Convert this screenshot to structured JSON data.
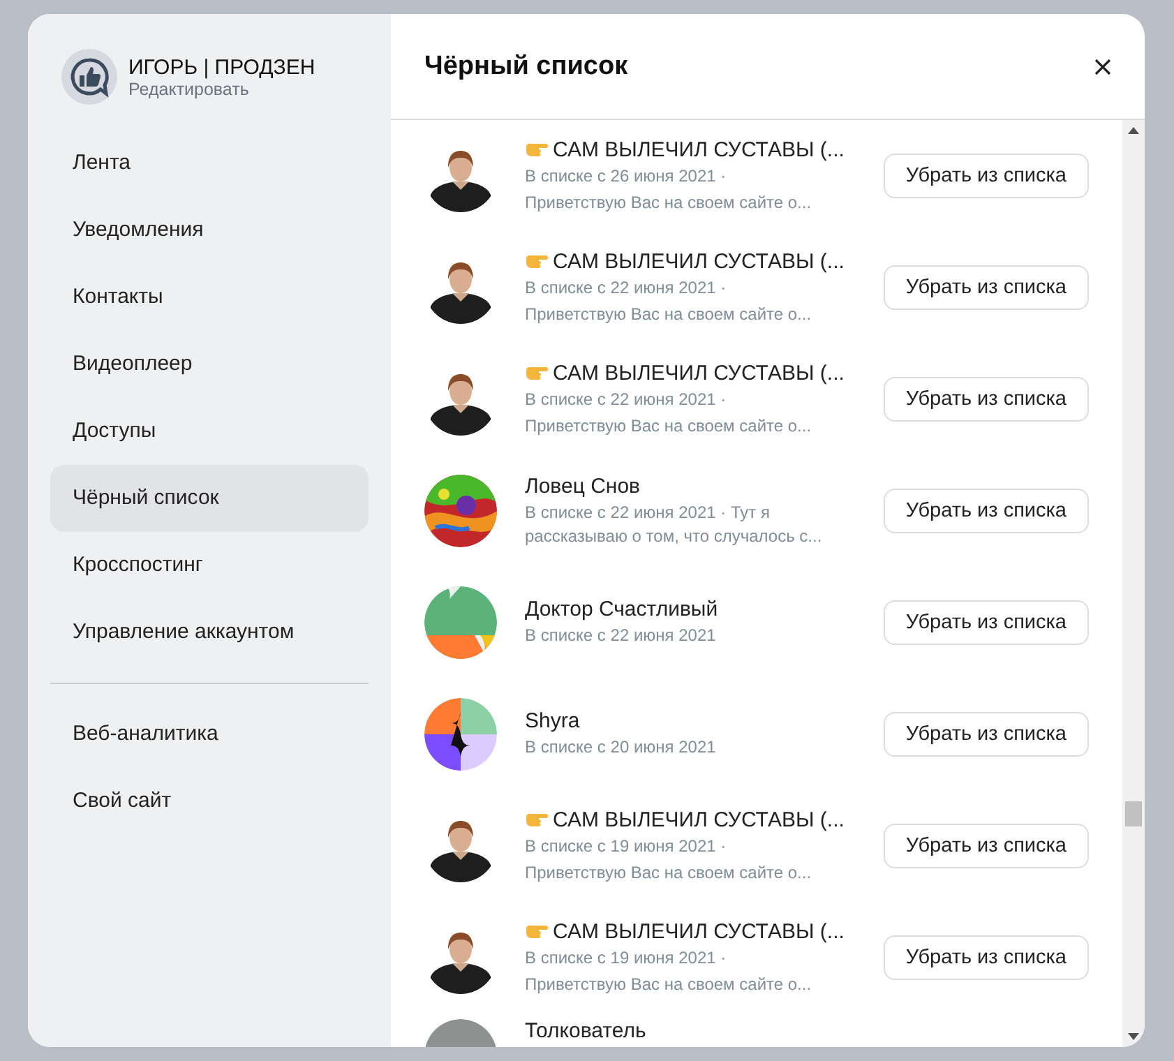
{
  "profile": {
    "name": "ИГОРЬ | ПРОДЗЕН",
    "link": "Редактировать"
  },
  "sidebar": {
    "sections": [
      [
        {
          "label": "Лента",
          "selected": false
        },
        {
          "label": "Уведомления",
          "selected": false
        },
        {
          "label": "Контакты",
          "selected": false
        },
        {
          "label": "Видеоплеер",
          "selected": false
        },
        {
          "label": "Доступы",
          "selected": false
        },
        {
          "label": "Чёрный список",
          "selected": true
        },
        {
          "label": "Кросспостинг",
          "selected": false
        },
        {
          "label": "Управление аккаунтом",
          "selected": false
        }
      ],
      [
        {
          "label": "Веб-аналитика",
          "selected": false
        },
        {
          "label": "Свой сайт",
          "selected": false
        }
      ]
    ]
  },
  "panel": {
    "title": "Чёрный список",
    "rows": [
      {
        "kind": "person",
        "pointer": true,
        "name": "САМ ВЫЛЕЧИЛ СУСТАВЫ (...",
        "info": "В списке с 26 июня 2021 ·",
        "desc": "Приветствую Вас на своем сайте о...",
        "button": "Убрать из списка"
      },
      {
        "kind": "person",
        "pointer": true,
        "name": "САМ ВЫЛЕЧИЛ СУСТАВЫ (...",
        "info": "В списке с 22 июня 2021 ·",
        "desc": "Приветствую Вас на своем сайте о...",
        "button": "Убрать из списка"
      },
      {
        "kind": "person",
        "pointer": true,
        "name": "САМ ВЫЛЕЧИЛ СУСТАВЫ (...",
        "info": "В списке с 22 июня 2021 ·",
        "desc": "Приветствую Вас на своем сайте о...",
        "button": "Убрать из списка"
      },
      {
        "kind": "swirl",
        "pointer": false,
        "name": "Ловец Снов",
        "info": "В списке с 22 июня 2021 · Тут я рассказываю о том, что случалось с...",
        "button": "Убрать из списка"
      },
      {
        "kind": "leaf",
        "pointer": false,
        "name": "Доктор Счастливый",
        "info": "В списке с 22 июня 2021",
        "button": "Убрать из списка"
      },
      {
        "kind": "quad",
        "pointer": false,
        "name": "Shyra",
        "info": "В списке с 20 июня 2021",
        "button": "Убрать из списка"
      },
      {
        "kind": "person",
        "pointer": true,
        "name": "САМ ВЫЛЕЧИЛ СУСТАВЫ (...",
        "info": "В списке с 19 июня 2021 ·",
        "desc": "Приветствую Вас на своем сайте о...",
        "button": "Убрать из списка"
      },
      {
        "kind": "person",
        "pointer": true,
        "name": "САМ ВЫЛЕЧИЛ СУСТАВЫ (...",
        "info": "В списке с 19 июня 2021 ·",
        "desc": "Приветствую Вас на своем сайте о...",
        "button": "Убрать из списка"
      },
      {
        "kind": "grey",
        "pointer": false,
        "name": "Толкователь"
      }
    ]
  }
}
